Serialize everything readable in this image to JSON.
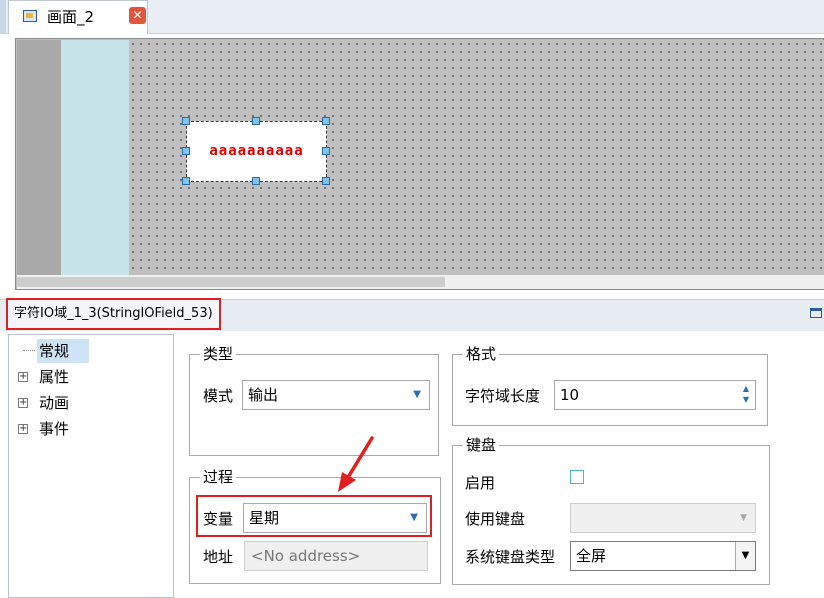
{
  "tab": {
    "label": "画面_2"
  },
  "canvas": {
    "io_field_text": "aaaaaaaaaa"
  },
  "properties": {
    "object_title": "字符IO域_1_3(StringIOField_53)",
    "tree": [
      {
        "label": "常规",
        "expandable": false,
        "selected": true
      },
      {
        "label": "属性",
        "expandable": true,
        "selected": false
      },
      {
        "label": "动画",
        "expandable": true,
        "selected": false
      },
      {
        "label": "事件",
        "expandable": true,
        "selected": false
      }
    ],
    "type_group": {
      "title": "类型",
      "mode_label": "模式",
      "mode_value": "输出"
    },
    "process_group": {
      "title": "过程",
      "variable_label": "变量",
      "variable_value": "星期",
      "address_label": "地址",
      "address_placeholder": "<No address>"
    },
    "format_group": {
      "title": "格式",
      "length_label": "字符域长度",
      "length_value": "10"
    },
    "keyboard_group": {
      "title": "键盘",
      "enable_label": "启用",
      "use_keyboard_label": "使用键盘",
      "system_keyboard_type_label": "系统键盘类型",
      "system_keyboard_type_value": "全屏"
    }
  },
  "colors": {
    "annotation_red": "#e02020",
    "io_text_red": "#e00000",
    "accent_blue": "#2e6bb5"
  }
}
